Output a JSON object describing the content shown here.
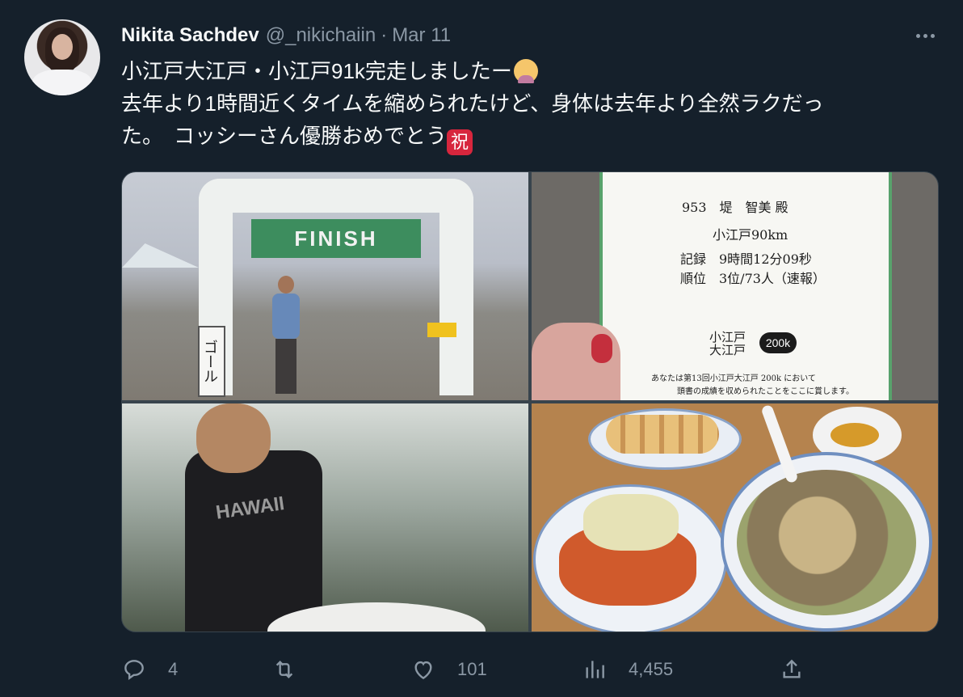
{
  "tweet": {
    "author_name": "Nikita Sachdev",
    "handle": "@_nikichaiin",
    "separator": "·",
    "date": "Mar 11",
    "text_line1": "小江戸大江戸・小江戸91k完走しましたー",
    "text_line2": "去年より1時間近くタイムを縮められたけど、身体は去年より全然ラクだっ",
    "text_line3": "た。　コッシーさん優勝おめでとう",
    "emoji_iwai": "祝"
  },
  "media": {
    "finish_banner": "FINISH",
    "goal_sign": "ゴール",
    "certificate": {
      "line1": "953　堤　智美 殿",
      "line2": "小江戸90km",
      "line3": "記録　9時間12分09秒",
      "line4": "順位　3位/73人（速報）",
      "logo": "小江戸 大江戸",
      "badge": "200k",
      "footer1": "あなたは第13回小江戸大江戸 200k において",
      "footer2": "頭書の成績を収められたことをここに賞します。"
    },
    "shirt_text": "HAWAII"
  },
  "actions": {
    "replies": "4",
    "retweets": "",
    "likes": "101",
    "views": "4,455"
  },
  "colors": {
    "background": "#15202b",
    "text_primary": "#f7f9f9",
    "text_secondary": "#8b98a5",
    "border": "#38444d"
  },
  "icons": [
    "reply-icon",
    "retweet-icon",
    "like-icon",
    "views-icon",
    "share-icon",
    "more-icon"
  ]
}
